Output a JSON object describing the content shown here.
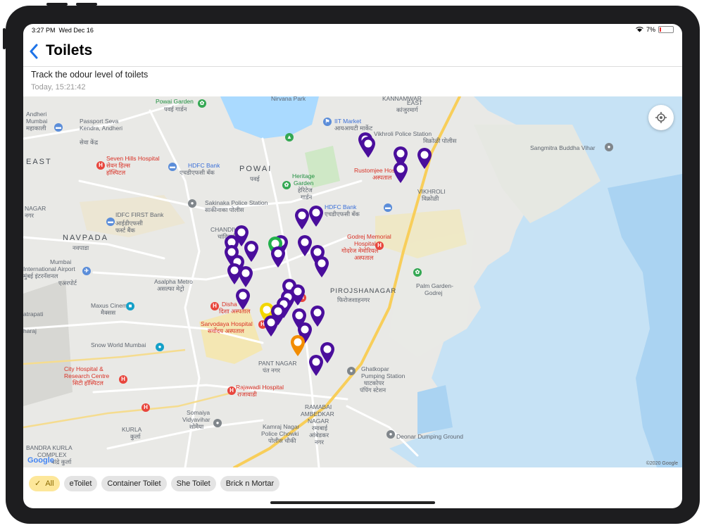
{
  "status_bar": {
    "time": "3:27 PM",
    "date": "Wed Dec 16",
    "battery": "7%"
  },
  "header": {
    "back_icon": "chevron-left-icon",
    "title": "Toilets",
    "subtitle": "Track the odour level of toilets",
    "timestamp": "Today, 15:21:42"
  },
  "map": {
    "labels": {
      "powai_garden": "Powai Garden",
      "powai_garden_dev": "पवई गार्डन",
      "nirvana_park": "Nirvana Park",
      "iit_market": "IIT Market",
      "iit_market_dev": "आयआयटी मार्केट",
      "kannamwar": "KANNAMWAR",
      "east_right": "EAST",
      "east_right_dev": "कांजुरमार्ग",
      "vikhroli_police": "Vikhroli Police Station",
      "vikhroli_police_dev": "विक्रोळी पोलीस",
      "andheri": "Andheri",
      "mumbai": "Mumbai",
      "andheri_dev": "महाकाली",
      "passport": "Passport Seva",
      "passport2": "Kendra, Andheri",
      "passport_dev": "सेवा केंद्र",
      "east_left": "EAST",
      "seven_hills": "Seven Hills Hospital",
      "seven_hills_dev": "सेवन हिल्स",
      "seven_hills_dev2": "हॉस्पिटल",
      "hdfc1": "HDFC Bank",
      "hdfc1_dev": "एचडीएफसी बँक",
      "powai": "POWAI",
      "powai_dev": "पवई",
      "heritage": "Heritage",
      "heritage2": "Garden",
      "heritage_dev": "हेरिटेज",
      "heritage_dev2": "गार्डन",
      "rustomjee": "Rustomjee Hospital",
      "rustomjee_dev": "अस्पताल",
      "vikhroli": "VIKHROLI",
      "vikhroli_dev": "विक्रोळी",
      "sangmitra": "Sangmitra Buddha Vihar",
      "nagar": "NAGAR",
      "nagar_dev": "नगर",
      "idfc": "IDFC FIRST Bank",
      "idfc_dev": "आईडीएफसी",
      "idfc_dev2": "फर्स्ट बैंक",
      "sakinaka": "Sakinaka Police Station",
      "sakinaka_dev": "साकीनाका पोलीस",
      "hdfc2": "HDFC Bank",
      "hdfc2_dev": "एचडीएफसी बँक",
      "chandivali": "CHANDIVALI",
      "chandivali_dev": "चांदिवली",
      "navpada": "NAVPADA",
      "navpada_dev": "नवपाडा",
      "godrej_mem": "Godrej Memorial",
      "godrej_mem2": "Hospital",
      "godrej_mem_dev": "गोदरेज मेमोरियल",
      "godrej_mem_dev2": "अस्पताल",
      "mumbai2": "Mumbai",
      "airport": "International Airport",
      "airport_dev": "मुंबई इंटरनॅशनल",
      "airport_dev2": "एअरपोर्ट",
      "asalpha": "Asalpha Metro",
      "asalpha_dev": "असल्फा मेट्रो",
      "pirojshanagar": "PIROJSHANAGAR",
      "pirojshanagar_dev": "फिरोजशाहनगर",
      "palm_garden": "Palm Garden-",
      "palm_garden2": "Godrej",
      "maxus": "Maxus Cinema",
      "maxus_dev": "मैक्सस",
      "disha": "Disha",
      "disha_dev": "दिशा अस्पताल",
      "sarvodaya": "Sarvodaya Hospital",
      "sarvodaya_dev": "सर्वोदय अस्पताल",
      "chhatrapati": "atrapati",
      "shivaji": "haraj",
      "snow_world": "Snow World Mumbai",
      "pant_nagar": "PANT NAGAR",
      "pant_nagar_dev": "पंत नगर",
      "ghatkopar": "Ghatkopar",
      "ghatkopar2": "Pumping Station",
      "ghatkopar_dev": "घाटकोपर",
      "ghatkopar_dev2": "पंपिंग स्टेशन",
      "city_hospital": "City Hospital &",
      "city_hospital2": "Research Centre",
      "city_hospital_dev": "सिटी हॉस्पिटल",
      "rajawadi": "Rajawadi Hospital",
      "rajawadi_dev": "राजावाडी",
      "ramabai": "RAMABAI",
      "ambedkar": "AMBEDKAR",
      "nagar2": "NAGAR",
      "ramabai_dev": "रमाबाई",
      "ramabai_dev2": "आंबेडकर",
      "ramabai_dev3": "नगर",
      "somaiya": "Somaiya",
      "somaiya2": "Vidyavihar",
      "somaiya_dev": "सोमैया",
      "kurla": "KURLA",
      "kurla_dev": "कुर्ला",
      "kamraj": "Kamraj Nagar",
      "kamraj2": "Police Chowki",
      "kamraj_dev": "पोलीस चौकी",
      "deonar": "Deonar Dumping Ground",
      "bkc": "BANDRA KURLA",
      "complex": "COMPLEX",
      "bkc_dev": "वांद्रे कुर्ला",
      "all_left": "All"
    },
    "google": "Google",
    "copyright": "©2020 Google",
    "locate_icon": "crosshair-icon",
    "colors": {
      "pin_default": "#4a0e9c",
      "pin_green": "#22b14c",
      "pin_yellow": "#f2d600",
      "pin_orange": "#f28c00",
      "water": "#aadaff",
      "park": "#c8e6c0",
      "highway": "#f9d76b"
    }
  },
  "filters": [
    {
      "label": "All",
      "active": true,
      "check_icon": "checkmark-icon"
    },
    {
      "label": "eToilet",
      "active": false
    },
    {
      "label": "Container Toilet",
      "active": false
    },
    {
      "label": "She Toilet",
      "active": false
    },
    {
      "label": "Brick n Mortar",
      "active": false
    }
  ]
}
